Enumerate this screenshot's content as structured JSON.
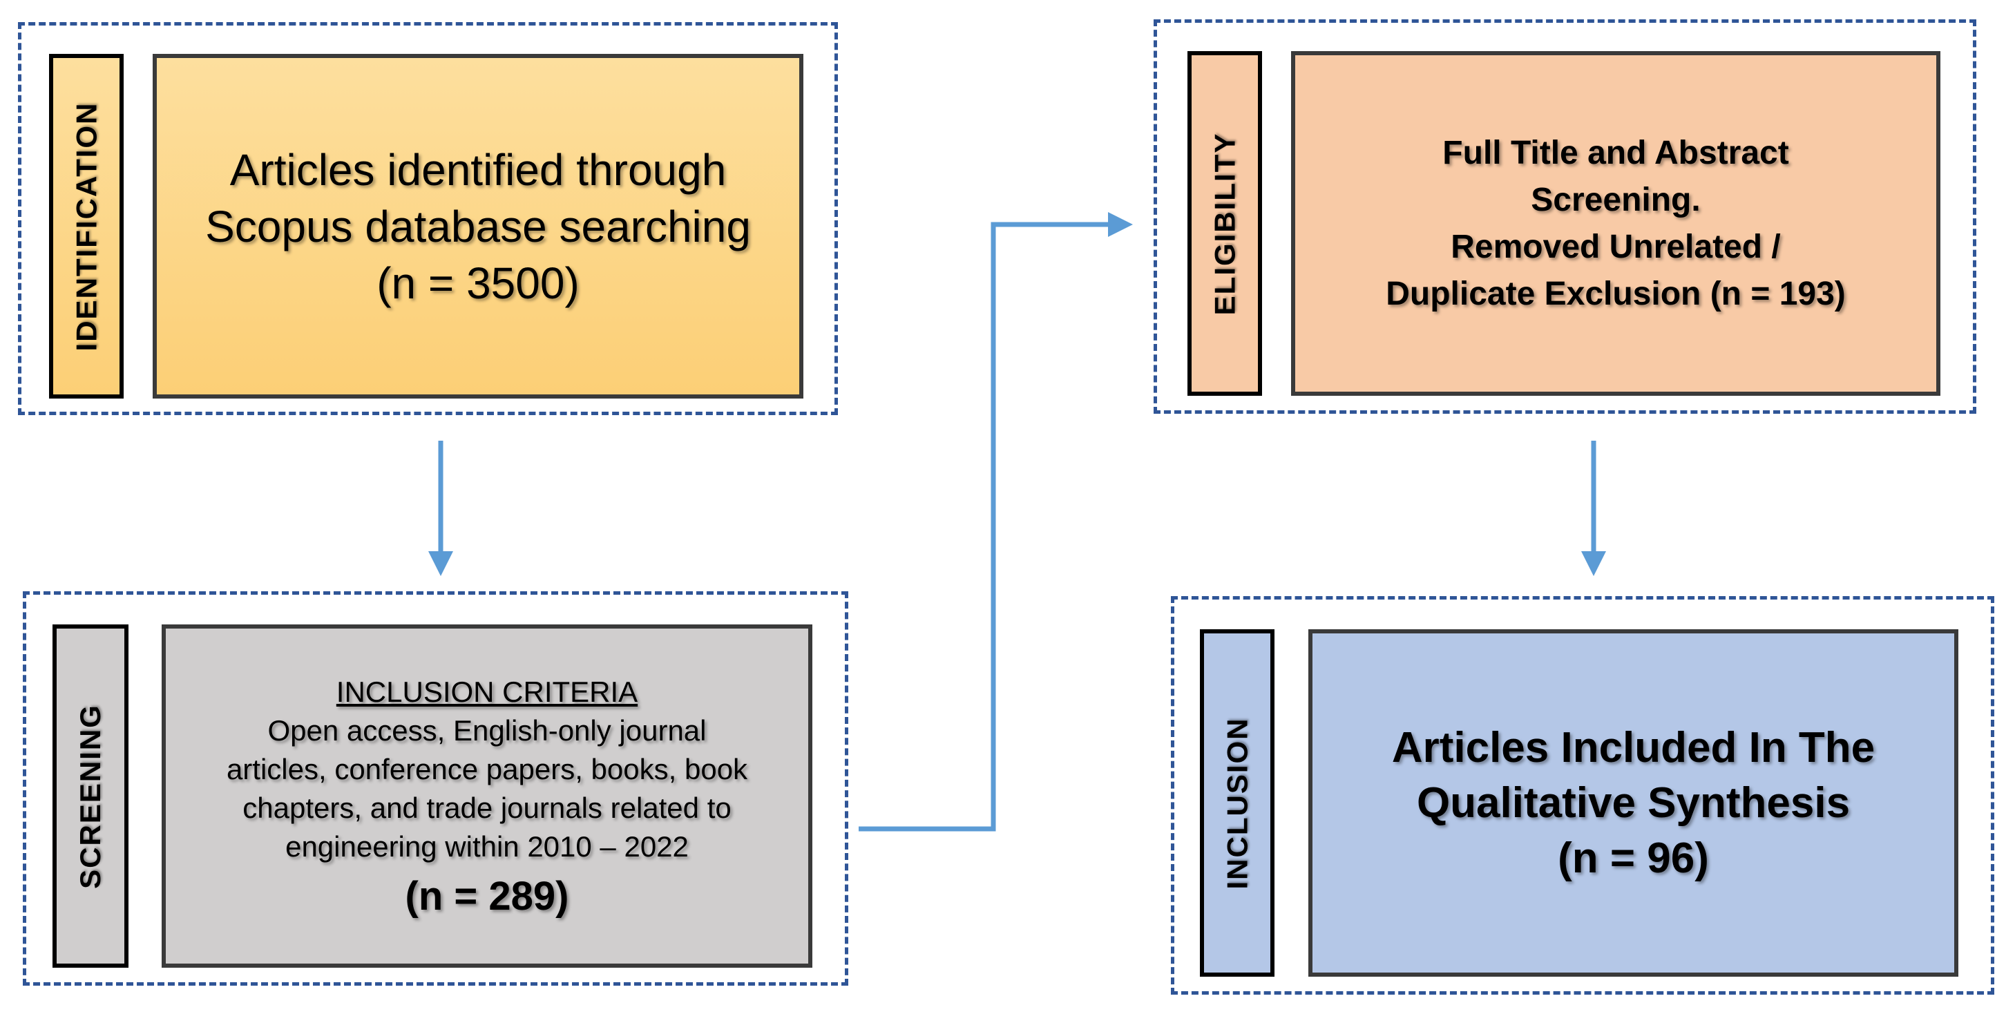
{
  "colors": {
    "border_dash": "#2f5597",
    "arrow": "#5b9bd5",
    "identification": "#fdd98c",
    "screening": "#d0cece",
    "eligibility": "#f8caa6",
    "inclusion": "#b4c7e7"
  },
  "identification": {
    "label": "IDENTIFICATION",
    "lines": [
      "Articles identified through",
      "Scopus database searching",
      "(n = 3500)"
    ]
  },
  "screening": {
    "label": "SCREENING",
    "heading": "INCLUSION CRITERIA",
    "lines": [
      "Open access, English-only journal",
      "articles, conference papers, books, book",
      "chapters, and trade journals related to",
      "engineering within 2010 – 2022"
    ],
    "count": "(n = 289)"
  },
  "eligibility": {
    "label": "ELIGIBILITY",
    "lines": [
      "Full Title and Abstract",
      "Screening.",
      "Removed Unrelated /",
      "Duplicate Exclusion (n = 193)"
    ]
  },
  "inclusion": {
    "label": "INCLUSION",
    "lines": [
      "Articles Included In The",
      "Qualitative Synthesis",
      "(n = 96)"
    ]
  }
}
